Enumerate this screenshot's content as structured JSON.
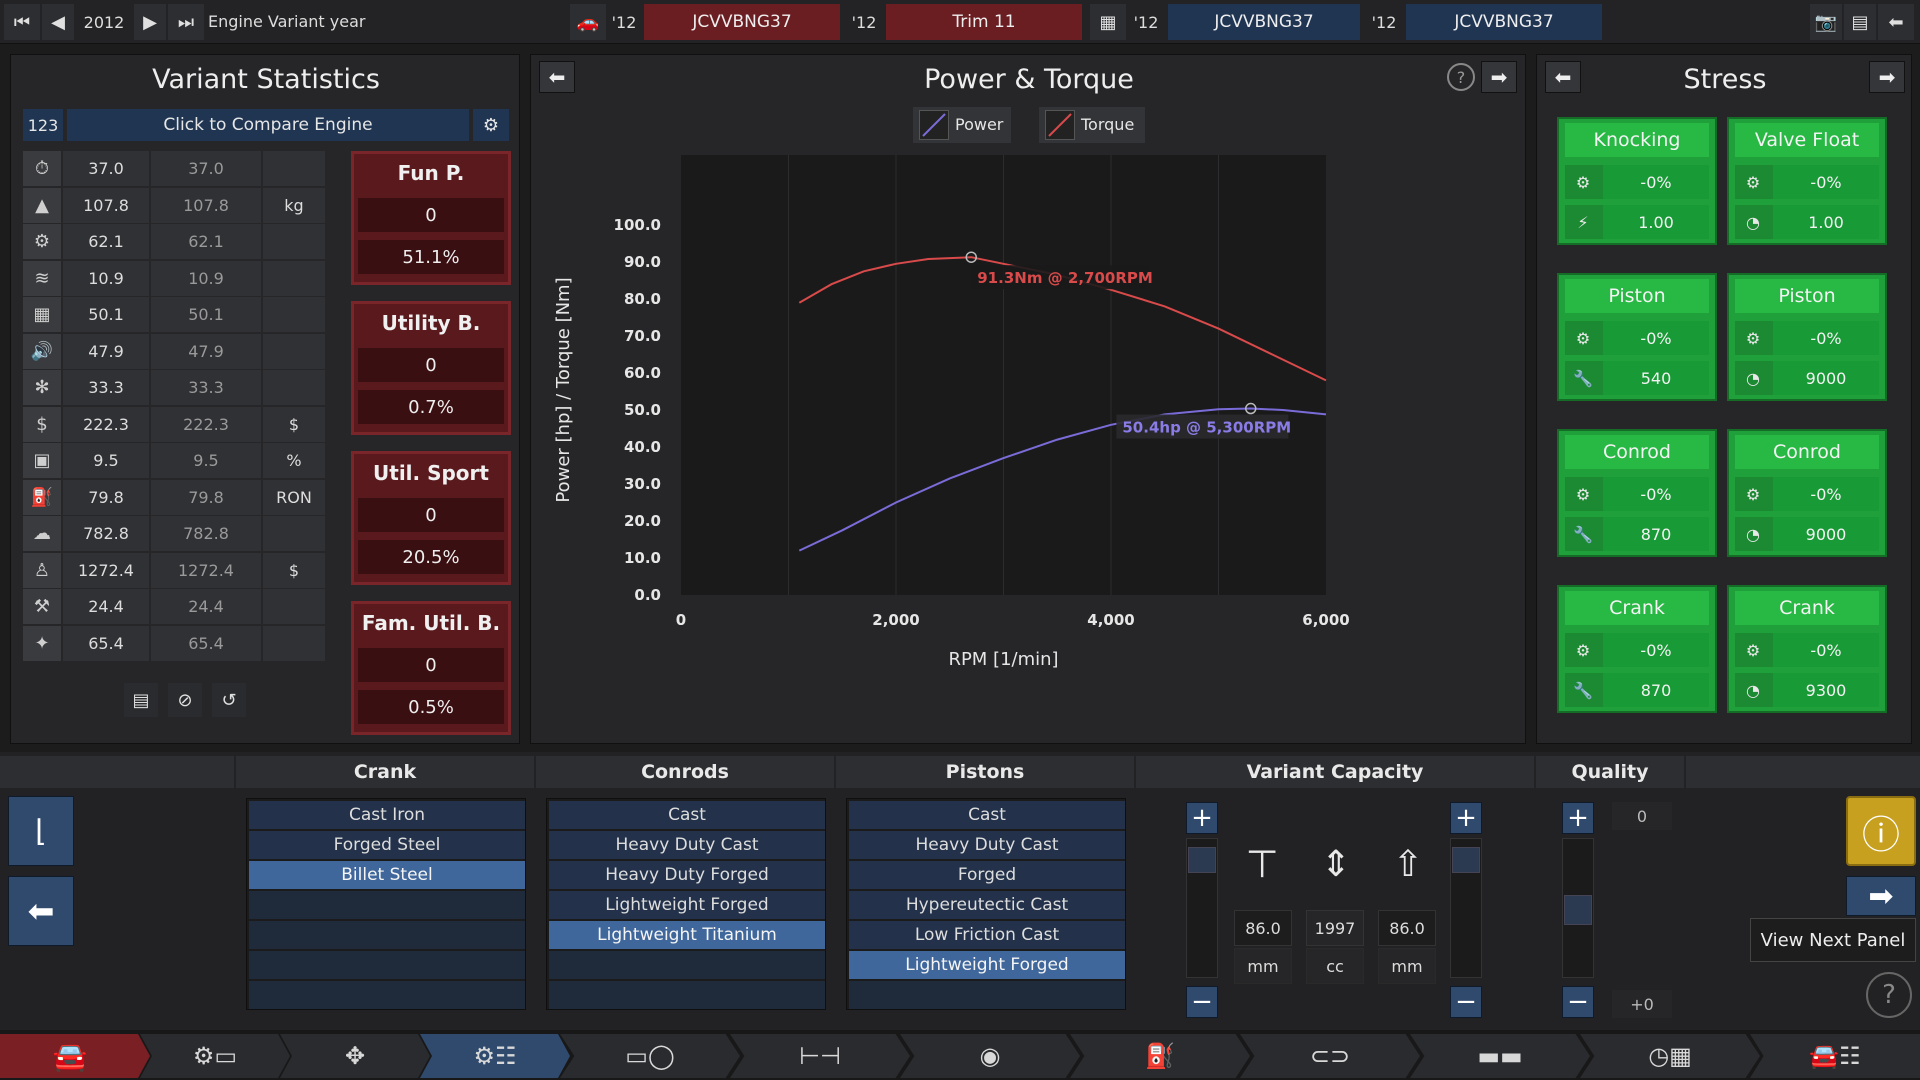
{
  "topbar": {
    "year": "2012",
    "variant_year_label": "Engine Variant year",
    "slot1_year": "'12",
    "slot1_engine": "JCVVBNG37",
    "slot2_year": "'12",
    "slot2_trim": "Trim 11",
    "slot3_year": "'12",
    "slot3_engine": "JCVVBNG37",
    "slot4_year": "'12",
    "slot4_engine": "JCVVBNG37"
  },
  "variant_stats": {
    "title": "Variant Statistics",
    "id_label": "123",
    "compare_label": "Click to Compare Engine",
    "rows": [
      {
        "icon": "stopwatch-icon",
        "glyph": "⏱",
        "value": "37.0",
        "compare": "37.0",
        "unit": ""
      },
      {
        "icon": "weight-icon",
        "glyph": "▲",
        "value": "107.8",
        "compare": "107.8",
        "unit": "kg"
      },
      {
        "icon": "engine-icon",
        "glyph": "⚙",
        "value": "62.1",
        "compare": "62.1",
        "unit": ""
      },
      {
        "icon": "vibration-icon",
        "glyph": "≋",
        "value": "10.9",
        "compare": "10.9",
        "unit": ""
      },
      {
        "icon": "radiator-icon",
        "glyph": "▦",
        "value": "50.1",
        "compare": "50.1",
        "unit": ""
      },
      {
        "icon": "sound-icon",
        "glyph": "🔊",
        "value": "47.9",
        "compare": "47.9",
        "unit": ""
      },
      {
        "icon": "cooling-icon",
        "glyph": "✻",
        "value": "33.3",
        "compare": "33.3",
        "unit": ""
      },
      {
        "icon": "cost-icon",
        "glyph": "$",
        "value": "222.3",
        "compare": "222.3",
        "unit": "$"
      },
      {
        "icon": "efficiency-icon",
        "glyph": "▣",
        "value": "9.5",
        "compare": "9.5",
        "unit": "%"
      },
      {
        "icon": "fuel-pump-icon",
        "glyph": "⛽",
        "value": "79.8",
        "compare": "79.8",
        "unit": "RON"
      },
      {
        "icon": "emissions-icon",
        "glyph": "☁",
        "value": "782.8",
        "compare": "782.8",
        "unit": ""
      },
      {
        "icon": "production-cost-icon",
        "glyph": "♙",
        "value": "1272.4",
        "compare": "1272.4",
        "unit": "$"
      },
      {
        "icon": "service-icon",
        "glyph": "⚒",
        "value": "24.4",
        "compare": "24.4",
        "unit": ""
      },
      {
        "icon": "reliability-icon",
        "glyph": "✦",
        "value": "65.4",
        "compare": "65.4",
        "unit": ""
      }
    ],
    "scores": [
      {
        "label": "Fun P.",
        "value": "0",
        "pct": "51.1%"
      },
      {
        "label": "Utility B.",
        "value": "0",
        "pct": "0.7%"
      },
      {
        "label": "Util. Sport",
        "value": "0",
        "pct": "20.5%"
      },
      {
        "label": "Fam. Util. B.",
        "value": "0",
        "pct": "0.5%"
      }
    ]
  },
  "power_torque": {
    "title": "Power & Torque",
    "legend_power": "Power",
    "legend_torque": "Torque",
    "xlabel": "RPM [1/min]",
    "ylabel": "Power [hp] / Torque [Nm]",
    "torque_annotation": "91.3Nm @ 2,700RPM",
    "power_annotation": "50.4hp @ 5,300RPM",
    "colors": {
      "power": "#7a6cd8",
      "torque": "#d94a4a"
    }
  },
  "chart_data": {
    "type": "line",
    "xlabel": "RPM [1/min]",
    "ylabel": "Power [hp] / Torque [Nm]",
    "xlim": [
      0,
      6000
    ],
    "ylim": [
      0,
      100
    ],
    "x_ticks": [
      "0",
      "2,000",
      "4,000",
      "6,000"
    ],
    "y_ticks": [
      "0.0",
      "10.0",
      "20.0",
      "30.0",
      "40.0",
      "50.0",
      "60.0",
      "70.0",
      "80.0",
      "90.0",
      "100.0"
    ],
    "grid": true,
    "legend": "top",
    "series": [
      {
        "name": "Power",
        "x": [
          1100,
          1500,
          2000,
          2500,
          3000,
          3500,
          4000,
          4500,
          5000,
          5300,
          5600,
          6000
        ],
        "values": [
          12.0,
          17.5,
          25.0,
          31.5,
          37.0,
          42.0,
          46.0,
          48.8,
          50.2,
          50.4,
          50.0,
          48.8
        ]
      },
      {
        "name": "Torque",
        "x": [
          1100,
          1400,
          1700,
          2000,
          2300,
          2700,
          3000,
          3500,
          4000,
          4500,
          5000,
          5500,
          6000
        ],
        "values": [
          79.0,
          84.0,
          87.5,
          89.5,
          90.8,
          91.3,
          89.5,
          86.5,
          82.5,
          78.0,
          72.0,
          65.0,
          58.0
        ]
      }
    ]
  },
  "stress": {
    "title": "Stress",
    "boxes": [
      {
        "title": "Knocking",
        "r1": "-0%",
        "r2": "1.00",
        "i2": "pressure-icon",
        "g2": "⚡"
      },
      {
        "title": "Valve Float",
        "r1": "-0%",
        "r2": "1.00",
        "i2": "gauge-icon",
        "g2": "◔"
      },
      {
        "title": "Piston",
        "r1": "-0%",
        "r2": "540",
        "i2": "wrench-icon",
        "g2": "🔧"
      },
      {
        "title": "Piston",
        "r1": "-0%",
        "r2": "9000",
        "i2": "gauge-icon",
        "g2": "◔"
      },
      {
        "title": "Conrod",
        "r1": "-0%",
        "r2": "870",
        "i2": "wrench-icon",
        "g2": "🔧"
      },
      {
        "title": "Conrod",
        "r1": "-0%",
        "r2": "9000",
        "i2": "gauge-icon",
        "g2": "◔"
      },
      {
        "title": "Crank",
        "r1": "-0%",
        "r2": "870",
        "i2": "wrench-icon",
        "g2": "🔧"
      },
      {
        "title": "Crank",
        "r1": "-0%",
        "r2": "9300",
        "i2": "gauge-icon",
        "g2": "◔"
      }
    ]
  },
  "bottom": {
    "crank": {
      "title": "Crank",
      "items": [
        "Cast Iron",
        "Forged Steel",
        "Billet Steel"
      ],
      "selected": 2
    },
    "conrods": {
      "title": "Conrods",
      "items": [
        "Cast",
        "Heavy Duty Cast",
        "Heavy Duty Forged",
        "Lightweight Forged",
        "Lightweight Titanium"
      ],
      "selected": 4
    },
    "pistons": {
      "title": "Pistons",
      "items": [
        "Cast",
        "Heavy Duty Cast",
        "Forged",
        "Hypereutectic Cast",
        "Low Friction Cast",
        "Lightweight Forged"
      ],
      "selected": 5
    },
    "capacity": {
      "title": "Variant Capacity",
      "bore": "86.0",
      "bore_unit": "mm",
      "displacement": "1997",
      "disp_unit": "cc",
      "stroke": "86.0",
      "stroke_unit": "mm"
    },
    "quality": {
      "title": "Quality",
      "value": "0",
      "delta": "+0"
    },
    "tooltip": "View Next Panel"
  }
}
